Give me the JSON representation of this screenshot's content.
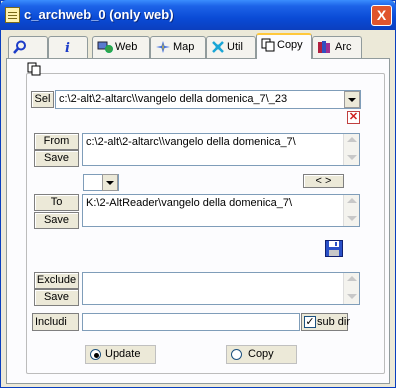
{
  "window": {
    "title": "c_archweb_0 (only web)",
    "close_glyph": "X"
  },
  "tabs": [
    {
      "id": "search",
      "label": "",
      "icon": "magnifier-icon"
    },
    {
      "id": "info",
      "label": "",
      "icon": "info-icon"
    },
    {
      "id": "web",
      "label": "Web",
      "icon": "web-icon"
    },
    {
      "id": "map",
      "label": "Map",
      "icon": "map-icon"
    },
    {
      "id": "util",
      "label": "Util",
      "icon": "util-icon"
    },
    {
      "id": "copy",
      "label": "Copy",
      "icon": "copy-icon",
      "active": true
    },
    {
      "id": "arc",
      "label": "Arc",
      "icon": "books-icon"
    }
  ],
  "copy": {
    "sel_label": "Sel",
    "sel_value": "c:\\2-alt\\2-altarc\\\\vangelo della domenica_7\\_23",
    "from_label": "From",
    "from_save_label": "Save",
    "from_value": "c:\\2-alt\\2-altarc\\\\vangelo della domenica_7\\",
    "swap_label": "< >",
    "to_label": "To",
    "to_save_label": "Save",
    "to_value": "K:\\2-AltReader\\vangelo della domenica_7\\",
    "exclude_label": "Exclude",
    "exclude_save_label": "Save",
    "exclude_value": "",
    "includi_label": "Includi",
    "includi_value": "",
    "subdir_label": "sub dir",
    "subdir_checked": true,
    "update_label": "Update",
    "copy_label": "Copy",
    "mode": "update"
  }
}
